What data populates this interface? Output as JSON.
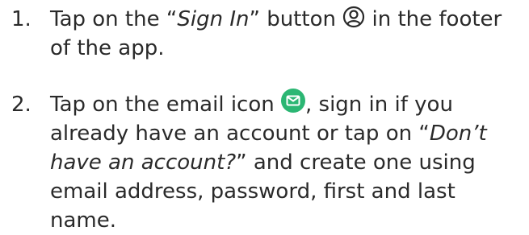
{
  "steps": [
    {
      "number": "1.",
      "line1_a": "Tap on the “",
      "line1_i": "Sign In",
      "line1_b": "” button ",
      "line1_c": " in the footer",
      "line2": "of the app."
    },
    {
      "number": "2.",
      "line1_a": "Tap on the email icon ",
      "line1_b": ", sign in if you",
      "line2_a": "already have an account or tap on “",
      "line2_i": "Don’t",
      "line3_i": "have an account?",
      "line3_b": "” and create one using",
      "line4": "email address, password, first and last",
      "line5": "name."
    }
  ],
  "icons": {
    "sign_in": "user-circle-icon",
    "email": "email-icon",
    "email_bg": "#2bb673"
  }
}
